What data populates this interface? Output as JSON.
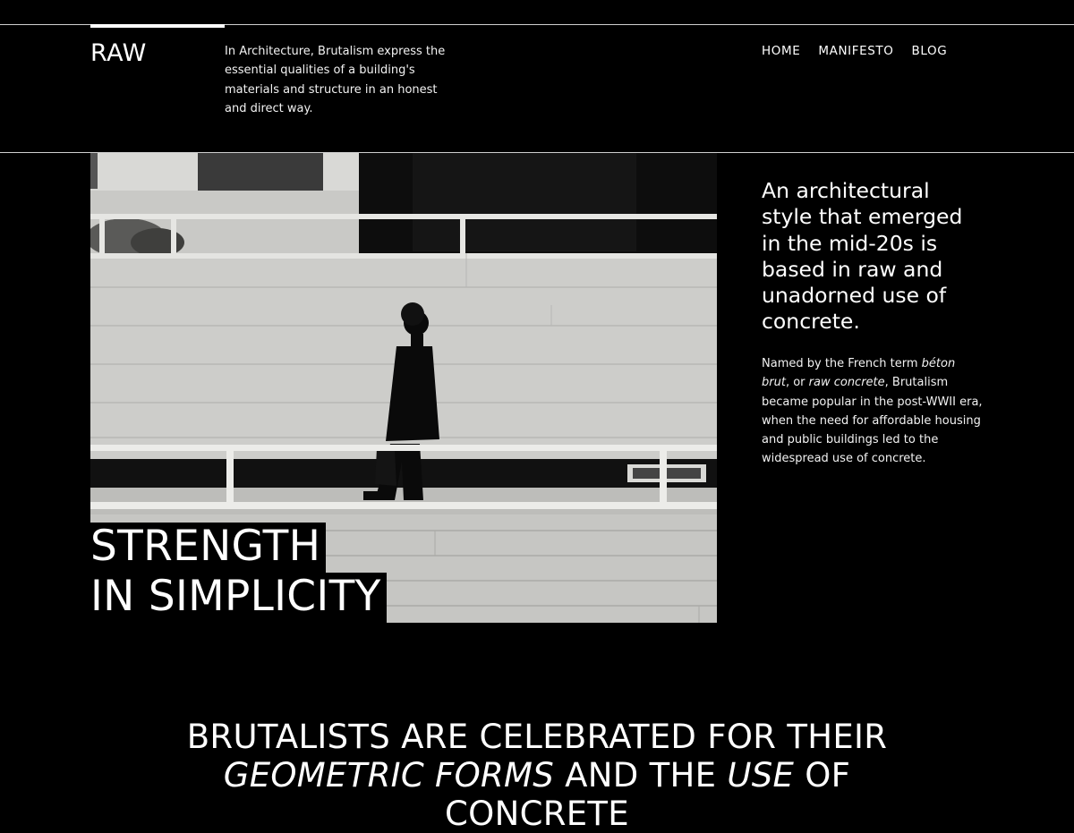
{
  "header": {
    "logo": "RAW",
    "intro": "In Architecture, Brutalism express the essential qualities of a building's materials and structure in an honest and direct way.",
    "nav": [
      {
        "label": "HOME"
      },
      {
        "label": "MANIFESTO"
      },
      {
        "label": "BLOG"
      }
    ]
  },
  "hero": {
    "title_line1": "STRENGTH",
    "title_line2": "IN SIMPLICITY",
    "image": "man-walking-concrete-wall-photo"
  },
  "side": {
    "heading": "An architectural style that emerged in the mid-20s is based in raw and unadorned use of concrete.",
    "body_p1": "Named by the French term ",
    "body_em1": "béton brut",
    "body_p2": ", or ",
    "body_em2": "raw concrete",
    "body_p3": ", Brutalism became popular in the post-WWII era, when the need for affordable housing and public buildings led to the widespread use of concrete."
  },
  "bottom": {
    "part1": "BRUTALISTS ARE CELEBRATED FOR THEIR ",
    "em1": "GEOMETRIC FORMS",
    "part2": " AND THE ",
    "em2": "USE",
    "part3": " OF CONCRETE"
  },
  "colors": {
    "background": "#000000",
    "text": "#ffffff",
    "rule": "#cfcfcf"
  }
}
